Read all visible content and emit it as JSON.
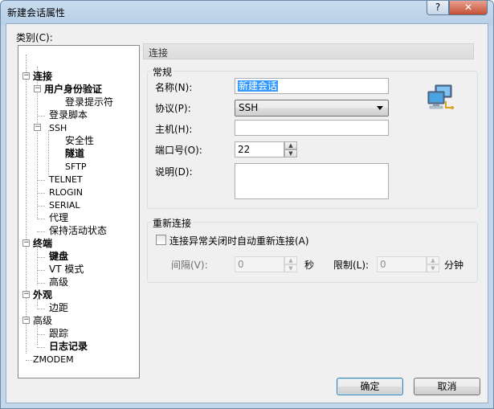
{
  "window": {
    "title": "新建会话属性",
    "help_label": "?",
    "close_label": "✕"
  },
  "category_label": "类别(C):",
  "tree": [
    {
      "label": "连接",
      "bold": true
    },
    {
      "label": "用户身份验证",
      "bold": true
    },
    {
      "label": "登录提示符"
    },
    {
      "label": "登录脚本"
    },
    {
      "label": "SSH"
    },
    {
      "label": "安全性"
    },
    {
      "label": "隧道",
      "bold": true
    },
    {
      "label": "SFTP"
    },
    {
      "label": "TELNET"
    },
    {
      "label": "RLOGIN"
    },
    {
      "label": "SERIAL"
    },
    {
      "label": "代理"
    },
    {
      "label": "保持活动状态"
    },
    {
      "label": "终端",
      "bold": true
    },
    {
      "label": "键盘",
      "bold": true
    },
    {
      "label": "VT 模式"
    },
    {
      "label": "高级"
    },
    {
      "label": "外观",
      "bold": true
    },
    {
      "label": "边距"
    },
    {
      "label": "高级"
    },
    {
      "label": "跟踪"
    },
    {
      "label": "日志记录",
      "bold": true
    },
    {
      "label": "ZMODEM"
    }
  ],
  "panel": {
    "header": "连接"
  },
  "general": {
    "title": "常规",
    "name_label": "名称(N):",
    "name_value": "新建会话",
    "protocol_label": "协议(P):",
    "protocol_value": "SSH",
    "host_label": "主机(H):",
    "host_value": "",
    "port_label": "端口号(O):",
    "port_value": "22",
    "desc_label": "说明(D):",
    "desc_value": ""
  },
  "reconnect": {
    "title": "重新连接",
    "checkbox_label": "连接异常关闭时自动重新连接(A)",
    "checked": false,
    "interval_label": "间隔(V):",
    "interval_value": "0",
    "seconds_label": "秒",
    "limit_label": "限制(L):",
    "limit_value": "0",
    "minutes_label": "分钟"
  },
  "buttons": {
    "ok": "确定",
    "cancel": "取消"
  },
  "icons": {
    "session": "network-computers-icon"
  }
}
